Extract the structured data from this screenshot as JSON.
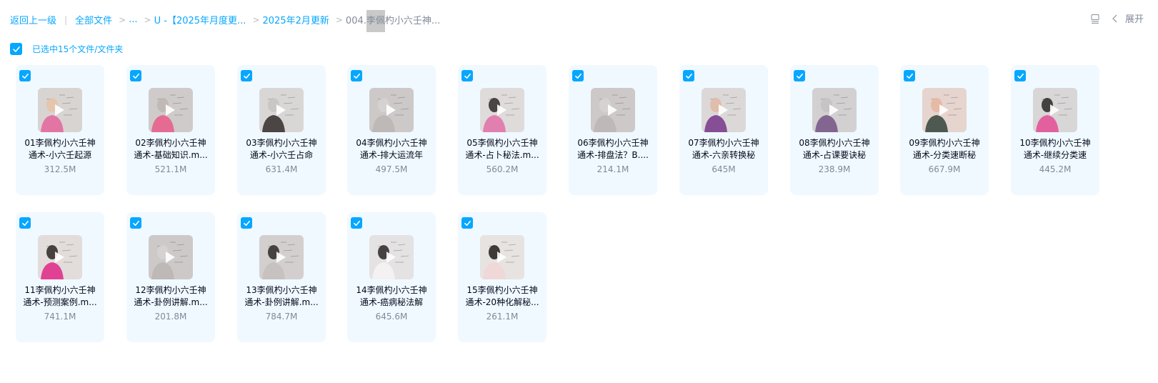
{
  "breadcrumb": {
    "back": "返回上一级",
    "root": "全部文件",
    "ellipsis": "...",
    "level1": "U -【2025年月度更...",
    "level2": "2025年2月更新",
    "current_prefix": "004.",
    "current_highlight": "李佩",
    "current_suffix": "杓小六壬神..."
  },
  "toolbar": {
    "expand_label": "展开"
  },
  "selection": {
    "summary": "已选中15个文件/文件夹"
  },
  "colors": {
    "accent": "#06a7ff",
    "card_bg": "#f0f9ff",
    "muted_text": "#818999"
  },
  "files": [
    {
      "line1": "01李佩杓小六壬神",
      "line2": "通术-小六壬起源",
      "size": "312.5M",
      "thumb": "pink"
    },
    {
      "line1": "02李佩杓小六壬神",
      "line2": "通术-基础知识.m...",
      "size": "521.1M",
      "thumb": "board-pink"
    },
    {
      "line1": "03李佩杓小六壬神",
      "line2": "通术-小六壬占命",
      "size": "631.4M",
      "thumb": "board-dark"
    },
    {
      "line1": "04李佩杓小六壬神",
      "line2": "通术-排大运流年",
      "size": "497.5M",
      "thumb": "board"
    },
    {
      "line1": "05李佩杓小六壬神",
      "line2": "通术-占卜秘法.m...",
      "size": "560.2M",
      "thumb": "person-board"
    },
    {
      "line1": "06李佩杓小六壬神",
      "line2": "通术-排盘法？B....",
      "size": "214.1M",
      "thumb": "board"
    },
    {
      "line1": "07李佩杓小六壬神",
      "line2": "通术-六亲转换秘",
      "size": "645M",
      "thumb": "purple"
    },
    {
      "line1": "08李佩杓小六壬神",
      "line2": "通术-占课要诀秘",
      "size": "238.9M",
      "thumb": "board-purple"
    },
    {
      "line1": "09李佩杓小六壬神",
      "line2": "通术-分类速断秘",
      "size": "667.9M",
      "thumb": "green-board"
    },
    {
      "line1": "10李佩杓小六壬神",
      "line2": "通术-继续分类速",
      "size": "445.2M",
      "thumb": "person-pink-board"
    },
    {
      "line1": "11李佩杓小六壬神",
      "line2": "通术-预测案例.m...",
      "size": "741.1M",
      "thumb": "magenta"
    },
    {
      "line1": "12李佩杓小六壬神",
      "line2": "通术-卦例讲解.m...",
      "size": "201.8M",
      "thumb": "board"
    },
    {
      "line1": "13李佩杓小六壬神",
      "line2": "通术-卦例讲解.m...",
      "size": "784.7M",
      "thumb": "board-hand"
    },
    {
      "line1": "14李佩杓小六壬神",
      "line2": "通术-癌病秘法解",
      "size": "645.6M",
      "thumb": "person-white"
    },
    {
      "line1": "15李佩杓小六壬神",
      "line2": "通术-20种化解秘...",
      "size": "261.1M",
      "thumb": "person-calligraphy"
    }
  ]
}
